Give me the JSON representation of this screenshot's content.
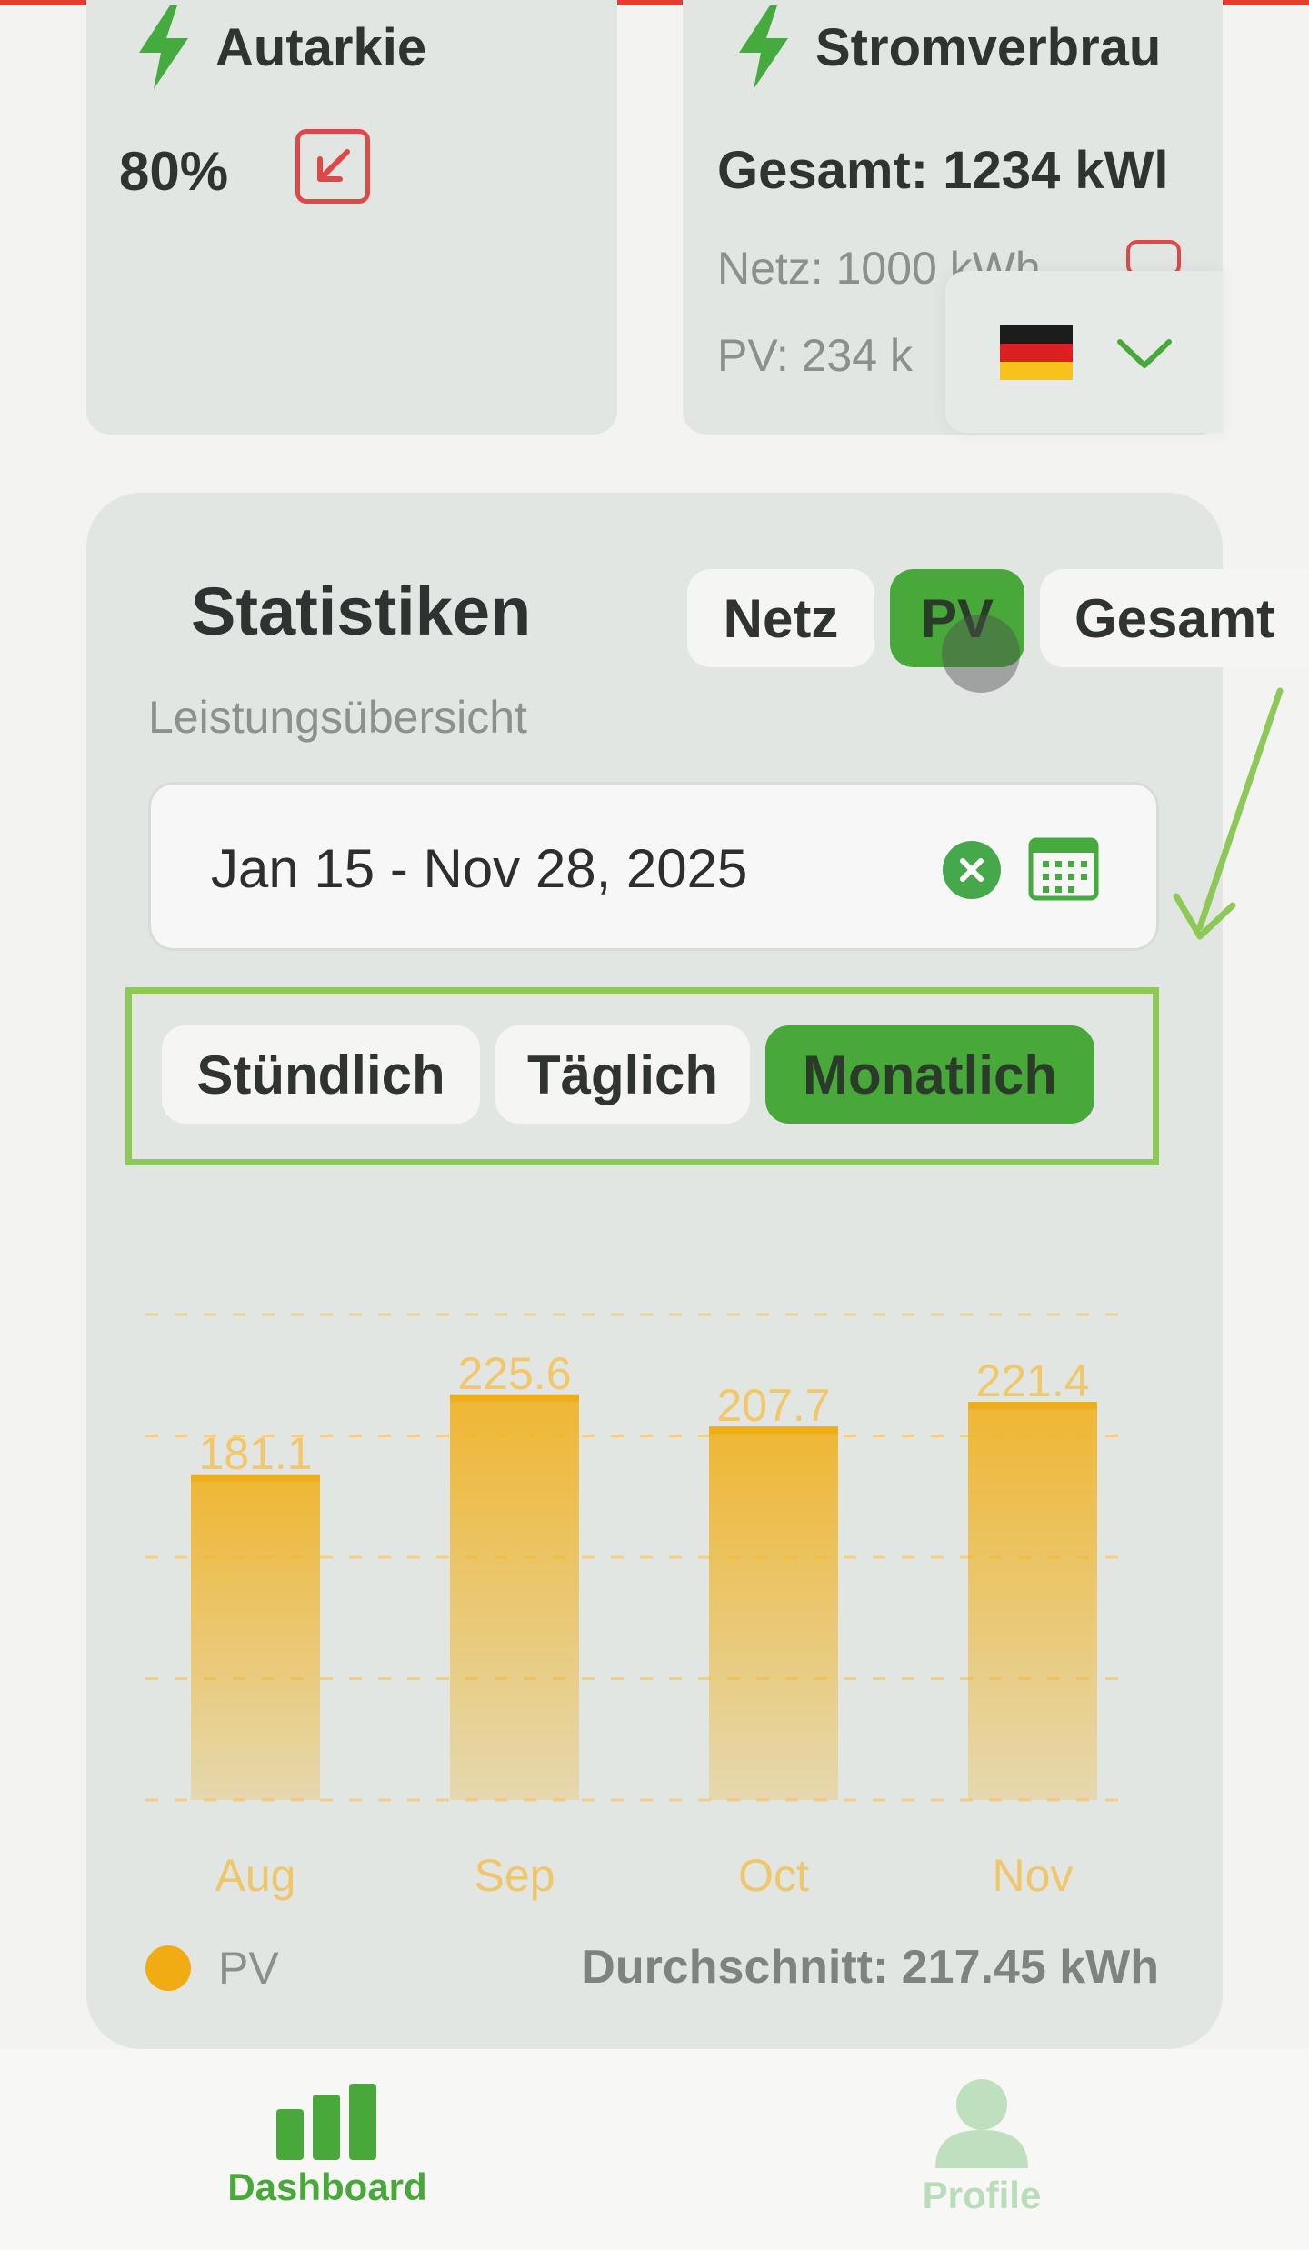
{
  "autarky_card": {
    "title": "Autarkie",
    "value": "80%",
    "trend_icon": "arrow-down-left-icon"
  },
  "consumption_card": {
    "title": "Stromverbrau",
    "total": "Gesamt: 1234 kWl",
    "grid_line": "Netz: 1000 kWh",
    "pv_line": "PV: 234 k"
  },
  "language_select": {
    "flag_icon": "germany-flag-icon",
    "chevron_icon": "chevron-down-icon"
  },
  "statistics": {
    "title": "Statistiken",
    "source_tabs": [
      {
        "label": "Netz",
        "active": false
      },
      {
        "label": "PV",
        "active": true
      },
      {
        "label": "Gesamt",
        "active": false
      }
    ],
    "subtitle": "Leistungsübersicht",
    "date_range": "Jan 15 - Nov 28, 2025",
    "interval_tabs": [
      {
        "label": "Stündlich",
        "active": false
      },
      {
        "label": "Täglich",
        "active": false
      },
      {
        "label": "Monatlich",
        "active": true
      }
    ],
    "legend_label": "PV",
    "average": "Durchschnitt: 217.45 kWh"
  },
  "chart_data": {
    "type": "bar",
    "categories": [
      "Aug",
      "Sep",
      "Oct",
      "Nov"
    ],
    "series": [
      {
        "name": "PV",
        "values": [
          181.1,
          225.6,
          207.7,
          221.4
        ]
      }
    ],
    "ylim": [
      0,
      270
    ],
    "grid": true,
    "legend": "bottom-left",
    "color": "#f0b429"
  },
  "bottom_nav": {
    "items": [
      {
        "label": "Dashboard",
        "icon": "bar-chart-icon",
        "active": true
      },
      {
        "label": "Profile",
        "icon": "user-icon",
        "active": false
      }
    ]
  },
  "colors": {
    "accent": "#48a83a",
    "alert": "#e04848",
    "highlight_box": "#8ec958",
    "bar": "#f0b429"
  }
}
